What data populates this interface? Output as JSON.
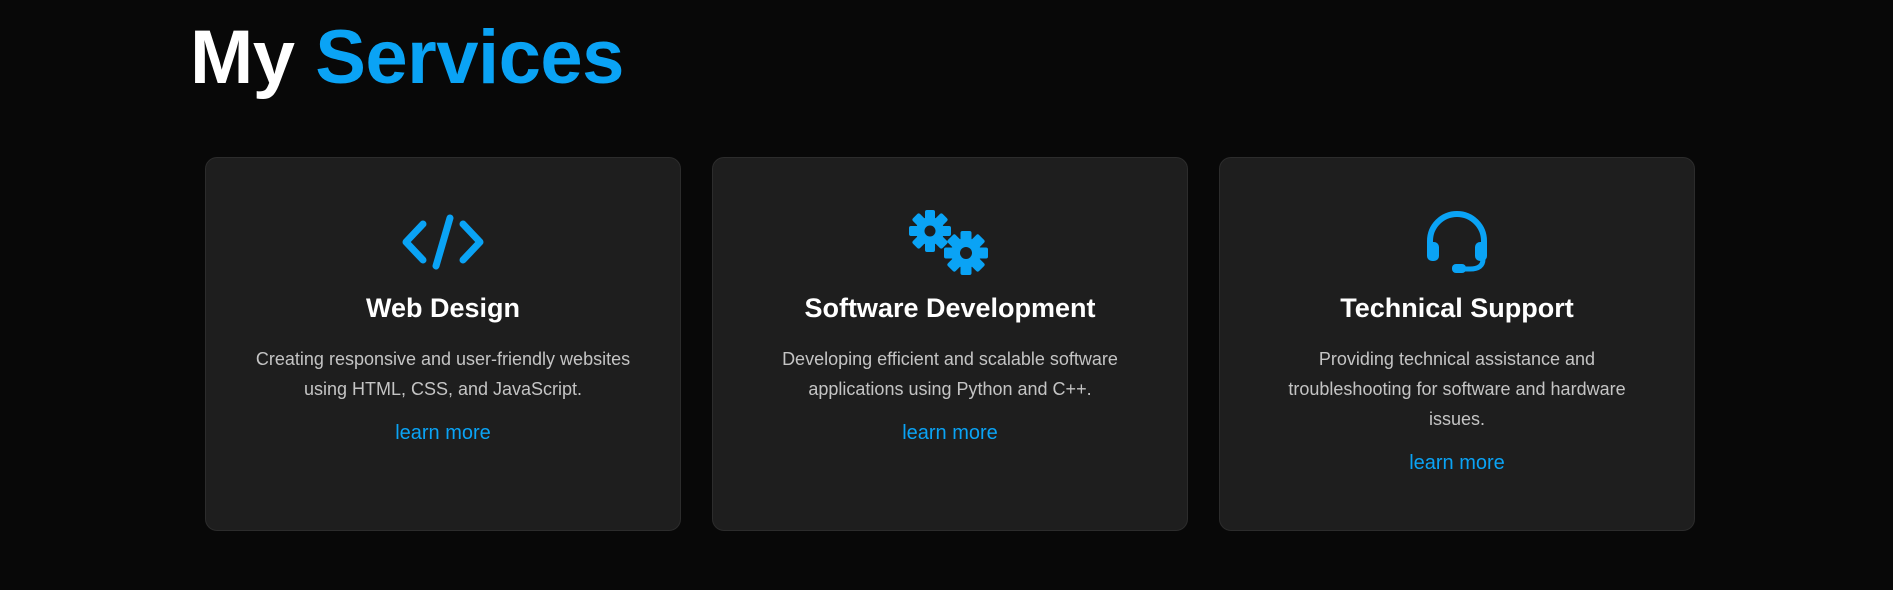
{
  "heading": {
    "prefix": "My",
    "accent": "Services"
  },
  "colors": {
    "accent": "#0aa3f5",
    "background": "#080808",
    "card": "#1e1e1e"
  },
  "cards": [
    {
      "icon": "code-icon",
      "title": "Web Design",
      "description": "Creating responsive and user-friendly websites using HTML, CSS, and JavaScript.",
      "link_label": "learn more"
    },
    {
      "icon": "gears-icon",
      "title": "Software Development",
      "description": "Developing efficient and scalable software applications using Python and C++.",
      "link_label": "learn more"
    },
    {
      "icon": "headset-icon",
      "title": "Technical Support",
      "description": "Providing technical assistance and troubleshooting for software and hardware issues.",
      "link_label": "learn more"
    }
  ]
}
